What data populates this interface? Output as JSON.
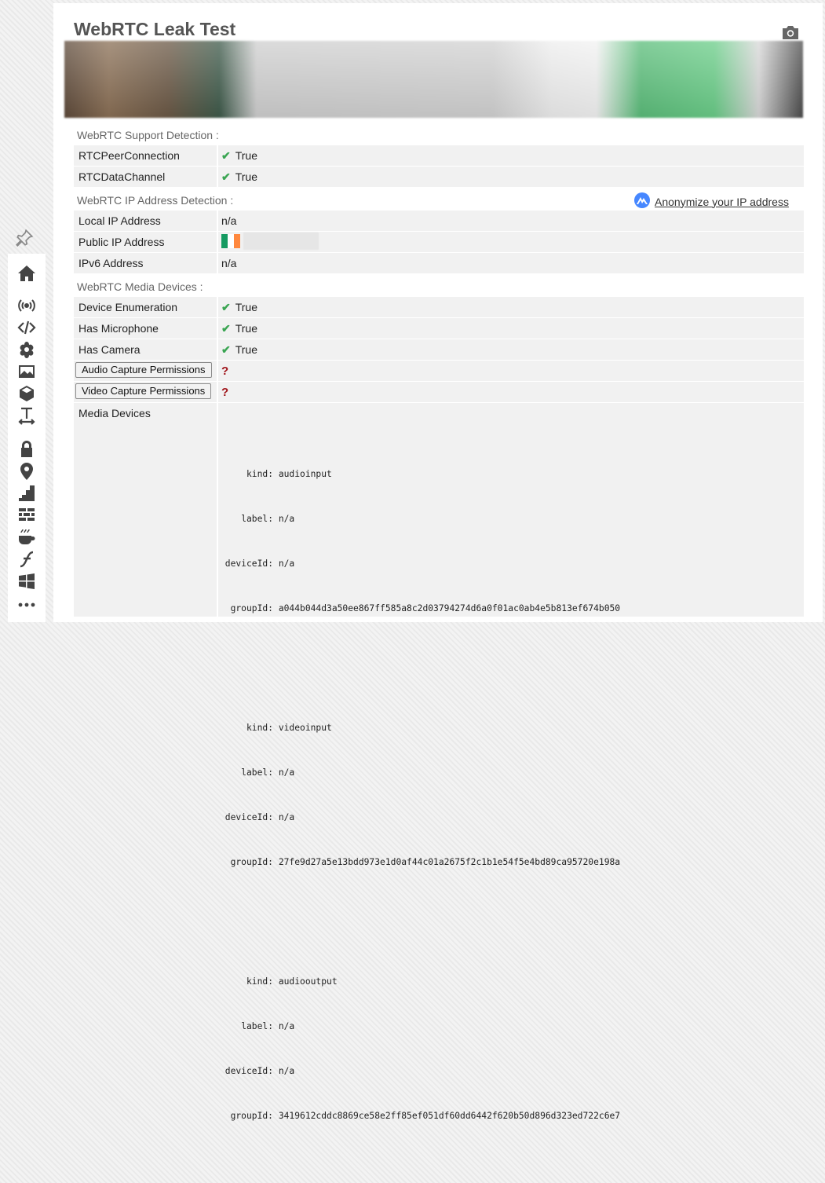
{
  "page": {
    "title": "WebRTC Leak Test"
  },
  "sections": {
    "support": "WebRTC Support Detection :",
    "ip": "WebRTC IP Address Detection :",
    "media": "WebRTC Media Devices :"
  },
  "anonymize_link": "Anonymize your IP address",
  "support_rows": [
    {
      "label": "RTCPeerConnection",
      "value": "True"
    },
    {
      "label": "RTCDataChannel",
      "value": "True"
    }
  ],
  "ip_rows": [
    {
      "label": "Local IP Address",
      "value": "n/a"
    },
    {
      "label": "Public IP Address",
      "value": ""
    },
    {
      "label": "IPv6 Address",
      "value": "n/a"
    }
  ],
  "media_rows": [
    {
      "label": "Device Enumeration",
      "value": "True"
    },
    {
      "label": "Has Microphone",
      "value": "True"
    },
    {
      "label": "Has Camera",
      "value": "True"
    }
  ],
  "buttons": {
    "audio": "Audio Capture Permissions",
    "video": "Video Capture Permissions",
    "unknown_mark": "?"
  },
  "media_devices": {
    "label": "Media Devices",
    "keys": {
      "kind": "kind:",
      "label": "label:",
      "deviceId": "deviceId:",
      "groupId": "groupId:"
    },
    "devices": [
      {
        "kind": "audioinput",
        "label": "n/a",
        "deviceId": "n/a",
        "groupId": "a044b044d3a50ee867ff585a8c2d03794274d6a0f01ac0ab4e5b813ef674b050"
      },
      {
        "kind": "videoinput",
        "label": "n/a",
        "deviceId": "n/a",
        "groupId": "27fe9d27a5e13bdd973e1d0af44c01a2675f2c1b1e54f5e4bd89ca95720e198a"
      },
      {
        "kind": "audiooutput",
        "label": "n/a",
        "deviceId": "n/a",
        "groupId": "3419612cddc8869ce58e2ff85ef051df60dd6442f620b50d896d323ed722c6e7"
      }
    ]
  },
  "colors": {
    "check": "#3aa552",
    "question": "#a0151b",
    "row_bg": "#f1f1f1"
  },
  "icons": [
    "pin-icon",
    "home-icon",
    "broadcast-icon",
    "code-icon",
    "flower-icon",
    "image-icon",
    "cube-icon",
    "text-height-icon",
    "lock-icon",
    "map-marker-icon",
    "stairs-icon",
    "brick-wall-icon",
    "coffee-icon",
    "flash-icon",
    "windows-icon",
    "more-icon"
  ]
}
